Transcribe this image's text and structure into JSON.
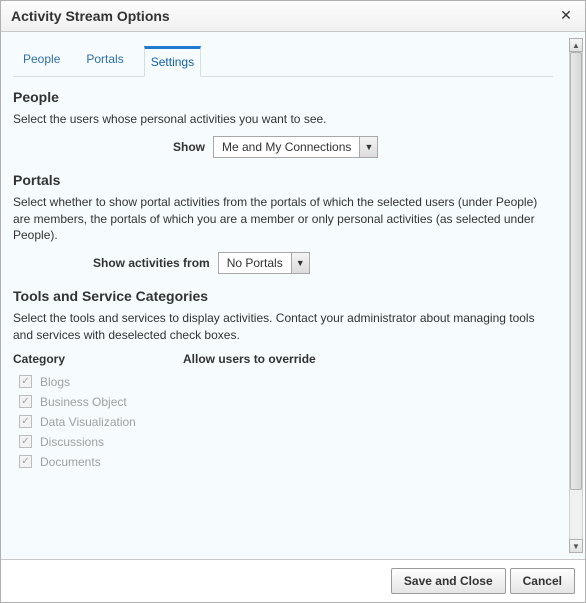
{
  "dialog": {
    "title": "Activity Stream Options"
  },
  "tabs": {
    "people": "People",
    "portals": "Portals",
    "settings": "Settings"
  },
  "people": {
    "heading": "People",
    "desc": "Select the users whose personal activities you want to see.",
    "show_label": "Show",
    "show_value": "Me and My Connections"
  },
  "portals": {
    "heading": "Portals",
    "desc": "Select whether to show portal activities from the portals of which the selected users (under People) are members, the portals of which you are a member or only personal activities (as selected under People).",
    "from_label": "Show activities from",
    "from_value": "No Portals"
  },
  "tools": {
    "heading": "Tools and Service Categories",
    "desc": "Select the tools and services to display activities. Contact your administrator about managing tools and services with deselected check boxes.",
    "col_category": "Category",
    "col_override": "Allow users to override",
    "items": [
      "Blogs",
      "Business Object",
      "Data Visualization",
      "Discussions",
      "Documents"
    ]
  },
  "footer": {
    "save": "Save and Close",
    "cancel": "Cancel"
  }
}
